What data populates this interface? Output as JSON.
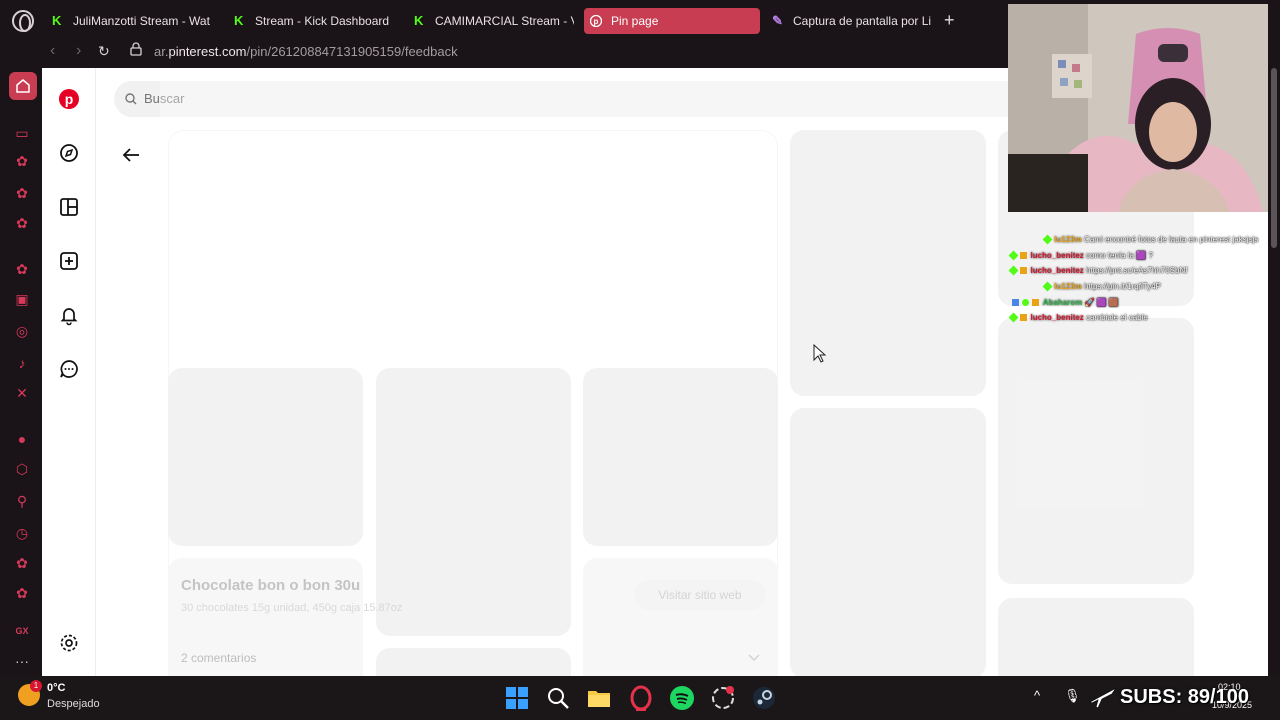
{
  "tabs": [
    {
      "label": "JuliManzotti Stream - Wat",
      "icon": "kick-icon",
      "active": false
    },
    {
      "label": "Stream - Kick Dashboard",
      "icon": "kick-icon",
      "active": false
    },
    {
      "label": "CAMIMARCIAL Stream - V",
      "icon": "kick-icon",
      "active": false
    },
    {
      "label": "Pin page",
      "icon": "pinterest-icon",
      "active": true
    },
    {
      "label": "Captura de pantalla por Li",
      "icon": "pen-icon",
      "active": false
    }
  ],
  "address": {
    "domain_prefix": "ar.",
    "domain": "pinterest.com",
    "path": "/pin/261208847131905159/feedback"
  },
  "search": {
    "placeholder": "Buscar"
  },
  "pin": {
    "title": "Chocolate bon o bon 30u",
    "description": "30 chocolates 15g unidad, 450g caja 15.87oz",
    "comments": "2 comentarios",
    "visit_label": "Visitar sitio web"
  },
  "chat": [
    {
      "user": "lu123m",
      "user_color": "#e8a317",
      "message": "Cami encontré fotos de lauta en pinterest jaksjsjs"
    },
    {
      "user": "lucho_benitez",
      "user_color": "#d6152f",
      "message": "como tenía la 🟪 ?"
    },
    {
      "user": "lucho_benitez",
      "user_color": "#d6152f",
      "message": "https://pnt.sc/eAs7hh70SbNf"
    },
    {
      "user": "lu123m",
      "user_color": "#e8a317",
      "message": "https://pin.it/1rqfiTy4P"
    },
    {
      "user": "Abaharom",
      "user_color": "#2db34a",
      "message": "🚀 🟪 🟫"
    },
    {
      "user": "lucho_benitez",
      "user_color": "#d6152f",
      "message": "cambiale el cable"
    }
  ],
  "weather": {
    "temp": "0°C",
    "condition": "Despejado",
    "badge": "1"
  },
  "overlay": {
    "subs": "SUBS: 89/100"
  },
  "clock": {
    "time": "02:10",
    "date": "10/9/2025"
  },
  "colors": {
    "accent": "#c83d52",
    "pinterest_red": "#e60023",
    "kick_green": "#53fc18"
  }
}
